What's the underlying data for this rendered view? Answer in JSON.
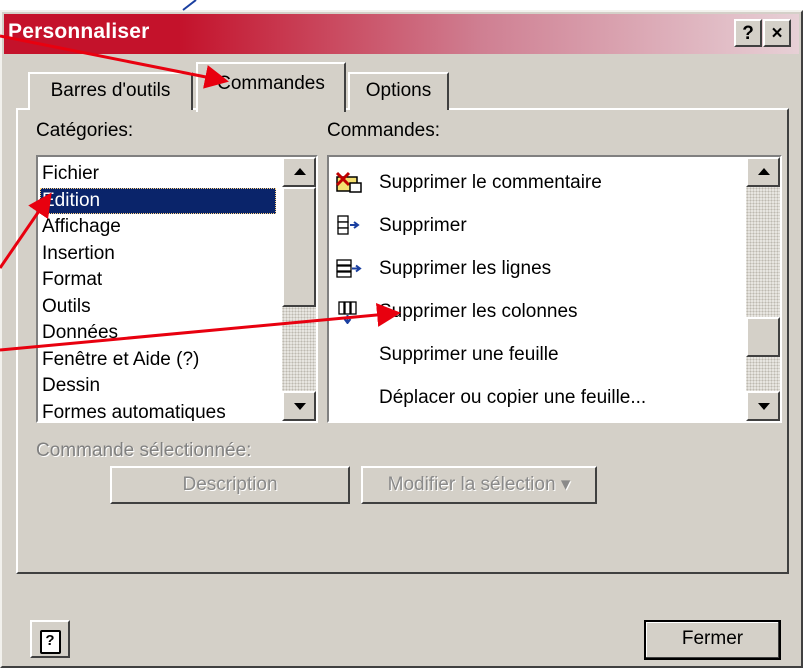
{
  "dialog": {
    "title": "Personnaliser",
    "help_button": "?",
    "close_button": "×"
  },
  "tabs": [
    {
      "label": "Barres d'outils",
      "selected": false
    },
    {
      "label": "Commandes",
      "selected": true
    },
    {
      "label": "Options",
      "selected": false
    }
  ],
  "categories": {
    "label": "Catégories:",
    "items": [
      {
        "label": "Fichier"
      },
      {
        "label": "Edition",
        "selected": true
      },
      {
        "label": "Affichage"
      },
      {
        "label": "Insertion"
      },
      {
        "label": "Format"
      },
      {
        "label": "Outils"
      },
      {
        "label": "Données"
      },
      {
        "label": "Fenêtre et Aide (?)"
      },
      {
        "label": "Dessin"
      },
      {
        "label": "Formes automatiques"
      }
    ]
  },
  "commands": {
    "label": "Commandes:",
    "items": [
      {
        "label": "Supprimer le commentaire",
        "icon": "delete-comment-icon"
      },
      {
        "label": "Supprimer",
        "icon": "delete-cells-icon"
      },
      {
        "label": "Supprimer les lignes",
        "icon": "delete-rows-icon"
      },
      {
        "label": "Supprimer les colonnes",
        "icon": "delete-columns-icon"
      },
      {
        "label": "Supprimer une feuille",
        "icon": ""
      },
      {
        "label": "Déplacer ou copier une feuille...",
        "icon": ""
      }
    ]
  },
  "selection": {
    "label": "Commande sélectionnée:",
    "description_button": "Description",
    "modify_button": "Modifier la sélection ▾"
  },
  "footer": {
    "help_icon_glyph": "?",
    "close_label": "Fermer"
  },
  "colors": {
    "title_gradient_start": "#c4122b",
    "title_gradient_end": "#e7d0d6",
    "selection_bg": "#0a246a",
    "annotation_arrow": "#e8000f",
    "face": "#d4d0c8"
  }
}
